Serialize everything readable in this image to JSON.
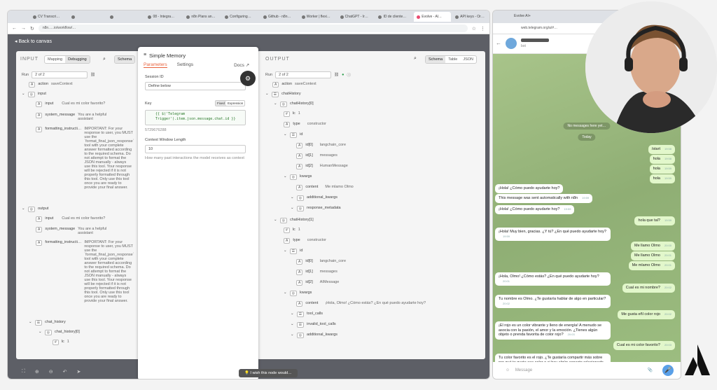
{
  "browser": {
    "tabs": [
      "CV Transcri…",
      "",
      "",
      "08 - Integra…",
      "n8n Plans an…",
      "Configuring…",
      "Github - n8n…",
      "Worker | flexi…",
      "ChatGPT - Ir…",
      "ID de cliente…",
      "Evolve - Al…",
      "API keys - Or…"
    ],
    "url": "n8n.….io/workflow/…",
    "telegram_tab": "Evolve AI+",
    "telegram_url": "web.telegram.org/a/#…"
  },
  "canvas": {
    "back_label": "Back to canvas"
  },
  "input": {
    "title": "INPUT",
    "mapping": "Mapping",
    "debugging": "Debugging",
    "schema": "Schema",
    "run": "Run",
    "run_value": "2 of 2",
    "action_key": "action",
    "action_val": "saveContext",
    "input_key": "input",
    "input_input_key": "input",
    "input_input_val": "Cual es mi color favorito?",
    "sys_key": "system_message",
    "sys_val": "You are a helpful assistant",
    "fmt_key": "formatting_instructi…",
    "fmt_val": "IMPORTANT: For your response to user, you MUST use the `format_final_json_response` tool with your complete answer formatted according to the required schema. Do not attempt to format the JSON manually - always use this tool. Your response will be rejected if it is not properly formatted through this tool. Only use this tool once you are ready to provide your final answer.",
    "output_key": "output",
    "out_input_key": "input",
    "out_input_val": "Cual es mi color favorito?",
    "out_sys_key": "system_message",
    "out_sys_val": "You are a helpful assistant",
    "out_fmt_key": "formatting_instructi…",
    "chat_history": "chat_history",
    "chat_history0": "chat_history[0]",
    "lc": "lc",
    "lc_val": "1"
  },
  "memory": {
    "title": "Simple Memory",
    "tab_parameters": "Parameters",
    "tab_settings": "Settings",
    "docs": "Docs",
    "session_label": "Session ID",
    "session_value": "Define below",
    "key_label": "Key",
    "fixed": "Fixed",
    "expression": "Expression",
    "code": "{{ $('Telegram Trigger').item.json.message.chat.id }}",
    "key_preview": "5729676288",
    "window_label": "Context Window Length",
    "window_value": "10",
    "window_hint": "How many past interactions the model receives as context"
  },
  "output": {
    "title": "OUTPUT",
    "schema": "Schema",
    "table": "Table",
    "json": "JSON",
    "run": "Run",
    "run_value": "2 of 2",
    "action_key": "action",
    "action_val": "saveContext",
    "chat_history": "chatHistory",
    "ch0": "chatHistory[0]",
    "lc": "lc",
    "lc_val": "1",
    "type": "type",
    "type_val": "constructor",
    "id": "id",
    "id0": "id[0]",
    "id0_val": "langchain_core",
    "id1": "id[1]",
    "id1_val": "messages",
    "id2": "id[2]",
    "id2_val": "HumanMessage",
    "kwargs": "kwargs",
    "content": "content",
    "content_val": "Me mlamo Olmo",
    "additional_kwargs": "additional_kwargs",
    "response_metadata": "response_metadata",
    "ch1": "chatHistory[1]",
    "lc_b": "lc",
    "lc_b_val": "1",
    "type_b": "type",
    "type_b_val": "constructor",
    "id_b": "id",
    "id0_b": "id[0]",
    "id0_b_val": "langchain_core",
    "id1_b": "id[1]",
    "id1_b_val": "messages",
    "id2_b": "id[2]",
    "id2_b_val": "AIMessage",
    "kwargs_b": "kwargs",
    "content_b": "content",
    "content_b_val": "¡Hola, Olmo! ¿Cómo estás? ¿En qué puedo ayudarte hoy?",
    "tool_calls": "tool_calls",
    "invalid_tool_calls": "invalid_tool_calls",
    "additional_kwargs_b": "additional_kwargs"
  },
  "wish": "I wish this node would…",
  "telegram": {
    "chat_status": "bot",
    "no_messages": "No messages here yet…",
    "today": "Today",
    "messages": [
      {
        "dir": "out",
        "text": "/start",
        "time": "19:58"
      },
      {
        "dir": "out",
        "text": "hola",
        "time": "19:58"
      },
      {
        "dir": "out",
        "text": "hola",
        "time": "19:59"
      },
      {
        "dir": "out",
        "text": "hola",
        "time": "19:59"
      },
      {
        "dir": "in",
        "text": "¡Hola! ¿Cómo puedo ayudarte hoy?",
        "time": ""
      },
      {
        "dir": "in",
        "text": "This message was sent automatically with n8n",
        "time": "19:59"
      },
      {
        "dir": "in",
        "text": "¡Hola! ¿Cómo puedo ayudarte hoy?",
        "time": "19:59"
      },
      {
        "dir": "out",
        "text": "hola que tal?",
        "time": "19:59"
      },
      {
        "dir": "in",
        "text": "¡Hola! Muy bien, gracias. ¿Y tú? ¿En qué puedo ayudarte hoy?",
        "time": "19:59"
      },
      {
        "dir": "out",
        "text": "Me llamo Olmo",
        "time": "20:00"
      },
      {
        "dir": "out",
        "text": "Me llamo Olmo",
        "time": "20:01"
      },
      {
        "dir": "out",
        "text": "Me mlamo Olmo",
        "time": "20:01"
      },
      {
        "dir": "in",
        "text": "¡Hola, Olmo! ¿Cómo estás? ¿En qué puedo ayudarte hoy?",
        "time": "20:01"
      },
      {
        "dir": "out",
        "text": "Cual es mi nombre?",
        "time": "20:02"
      },
      {
        "dir": "in",
        "text": "Tu nombre es Olmo. ¿Te gustaría hablar de algo en particular?",
        "time": "20:02"
      },
      {
        "dir": "out",
        "text": "Me gusta eñl color rojo",
        "time": "20:02"
      },
      {
        "dir": "in",
        "text": "¡El rojo es un color vibrante y lleno de energía! A menudo se asocia con la pasión, el amor y la emoción. ¿Tienes algún objeto o prenda favorita de color rojo?",
        "time": "20:03"
      },
      {
        "dir": "out",
        "text": "Cual es mi color favorito?",
        "time": "20:03"
      },
      {
        "dir": "in",
        "text": "Tu color favorito es el rojo. ¿Te gustaría compartir más sobre por qué te gusta ese color o si hay algún aspecto relacionado con él que te interese?",
        "time": "20:03"
      }
    ],
    "input_placeholder": "Message"
  }
}
